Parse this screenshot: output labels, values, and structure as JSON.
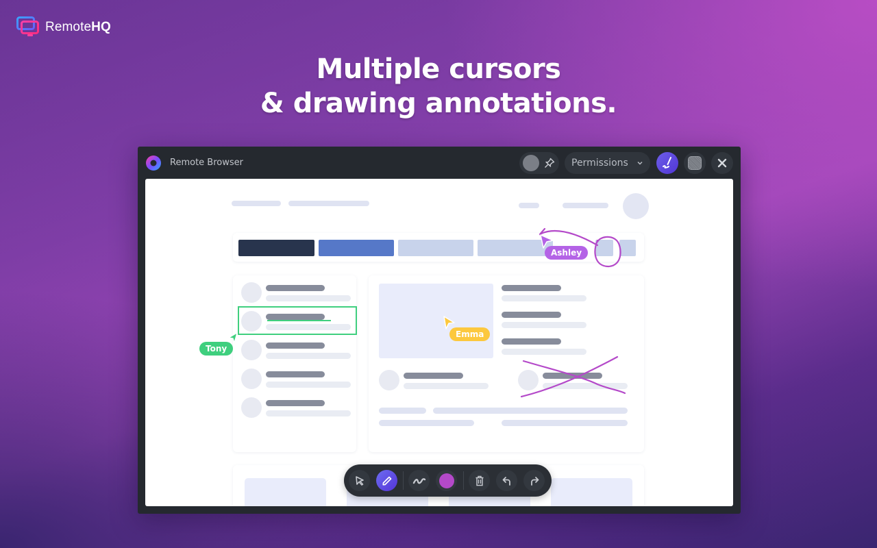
{
  "brand": {
    "name_regular": "Remote",
    "name_bold": "HQ",
    "icon": "monitor-logo-icon"
  },
  "headline": {
    "line1": "Multiple cursors",
    "line2": "& drawing annotations."
  },
  "window": {
    "title": "Remote Browser",
    "browser_icon": "browser-logo-icon",
    "permissions_label": "Permissions",
    "icons": {
      "pin": "pin-icon",
      "chevron": "chevron-down-icon",
      "annotate": "annotate-pen-icon",
      "blur": "blur-icon",
      "close": "close-icon"
    }
  },
  "cursors": [
    {
      "name": "Ashley",
      "color": "#b463e6"
    },
    {
      "name": "Tony",
      "color": "#3fcf7e"
    },
    {
      "name": "Emma",
      "color": "#fcc83e"
    }
  ],
  "toolbar": {
    "tools": [
      {
        "name": "select",
        "icon": "pointer-icon",
        "active": false
      },
      {
        "name": "pen",
        "icon": "pen-icon",
        "active": true
      },
      {
        "name": "stroke",
        "icon": "squiggle-icon",
        "active": false
      },
      {
        "name": "color",
        "icon": "color-swatch",
        "active": false,
        "color": "#b449c9"
      },
      {
        "name": "delete",
        "icon": "trash-icon",
        "active": false
      },
      {
        "name": "undo",
        "icon": "undo-icon",
        "active": false
      },
      {
        "name": "redo",
        "icon": "redo-icon",
        "active": false
      }
    ]
  },
  "colors": {
    "accent": "#5a41dd",
    "annotation_purple": "#b449c9",
    "annotation_green": "#3fcf7e",
    "window_bg": "#25292f"
  }
}
